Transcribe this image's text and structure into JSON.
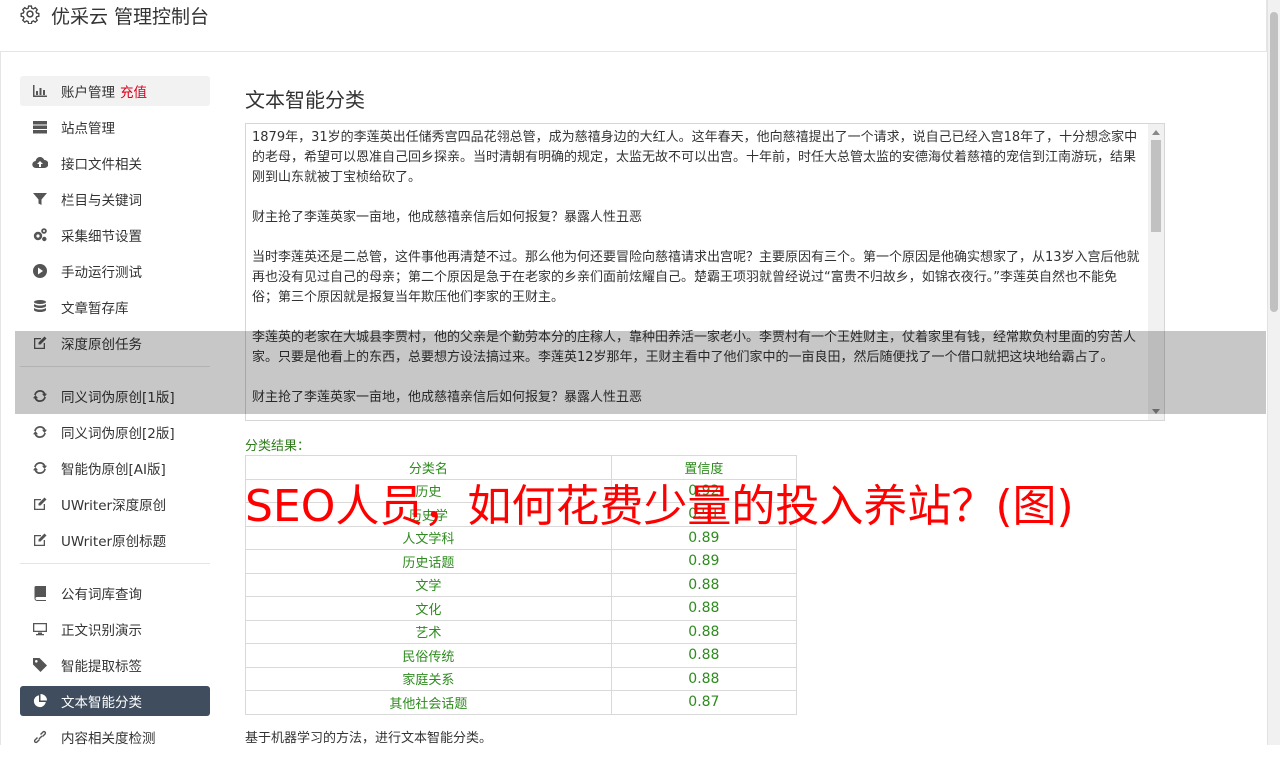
{
  "header": {
    "title": "优采云 管理控制台",
    "icon": "gear-icon"
  },
  "sidebar": {
    "group1": [
      {
        "label": "账户管理",
        "extra": "充值",
        "icon": "bar-chart-icon",
        "active": false
      },
      {
        "label": "站点管理",
        "icon": "server-icon"
      },
      {
        "label": "接口文件相关",
        "icon": "cloud-upload-icon"
      },
      {
        "label": "栏目与关键词",
        "icon": "filter-icon"
      },
      {
        "label": "采集细节设置",
        "icon": "cogs-icon"
      },
      {
        "label": "手动运行测试",
        "icon": "play-circle-icon"
      },
      {
        "label": "文章暂存库",
        "icon": "database-icon"
      },
      {
        "label": "深度原创任务",
        "icon": "edit-icon"
      }
    ],
    "group2": [
      {
        "label": "同义词伪原创[1版]",
        "icon": "refresh-icon"
      },
      {
        "label": "同义词伪原创[2版]",
        "icon": "refresh-icon"
      },
      {
        "label": "智能伪原创[AI版]",
        "icon": "refresh-icon"
      },
      {
        "label": "UWriter深度原创",
        "icon": "edit-icon"
      },
      {
        "label": "UWriter原创标题",
        "icon": "edit-icon"
      }
    ],
    "group3": [
      {
        "label": "公有词库查询",
        "icon": "book-icon"
      },
      {
        "label": "正文识别演示",
        "icon": "monitor-icon"
      },
      {
        "label": "智能提取标签",
        "icon": "tag-icon"
      },
      {
        "label": "文本智能分类",
        "icon": "pie-chart-icon",
        "active": true
      },
      {
        "label": "内容相关度检测",
        "icon": "link-icon"
      }
    ]
  },
  "main": {
    "title": "文本智能分类",
    "text_paragraphs": [
      "1879年，31岁的李莲英出任储秀宫四品花翎总管，成为慈禧身边的大红人。这年春天，他向慈禧提出了一个请求，说自己已经入宫18年了，十分想念家中的老母，希望可以恩准自己回乡探亲。当时清朝有明确的规定，太监无故不可以出宫。十年前，时任大总管太监的安德海仗着慈禧的宠信到江南游玩，结果刚到山东就被丁宝桢给砍了。",
      "财主抢了李莲英家一亩地，他成慈禧亲信后如何报复？暴露人性丑恶",
      "当时李莲英还是二总管，这件事他再清楚不过。那么他为何还要冒险向慈禧请求出宫呢？主要原因有三个。第一个原因是他确实想家了，从13岁入宫后他就再也没有见过自己的母亲；第二个原因是急于在老家的乡亲们面前炫耀自己。楚霸王项羽就曾经说过“富贵不归故乡，如锦衣夜行。”李莲英自然也不能免俗；第三个原因就是报复当年欺压他们李家的王财主。",
      "李莲英的老家在大城县李贾村，他的父亲是个勤劳本分的庄稼人，靠种田养活一家老小。李贾村有一个王姓财主，仗着家里有钱，经常欺负村里面的穷苦人家。只要是他看上的东西，总要想方设法搞过来。李莲英12岁那年，王财主看中了他们家中的一亩良田，然后随便找了一个借口就把这块地给霸占了。",
      "财主抢了李莲英家一亩地，他成慈禧亲信后如何报复？暴露人性丑恶"
    ],
    "result_label": "分类结果：",
    "table": {
      "headers": [
        "分类名",
        "置信度"
      ],
      "rows": [
        [
          "历史",
          "0.92"
        ],
        [
          "历史学",
          "0.91"
        ],
        [
          "人文学科",
          "0.89"
        ],
        [
          "历史话题",
          "0.89"
        ],
        [
          "文学",
          "0.88"
        ],
        [
          "文化",
          "0.88"
        ],
        [
          "艺术",
          "0.88"
        ],
        [
          "民俗传统",
          "0.88"
        ],
        [
          "家庭关系",
          "0.88"
        ],
        [
          "其他社会话题",
          "0.87"
        ]
      ]
    },
    "footnote": "基于机器学习的方法，进行文本智能分类。",
    "watermark": "SEO人员，如何花费少量的投入养站？(图)"
  },
  "colors": {
    "accent_active": "#3f4d5e",
    "result_green": "#2e8b1e",
    "watermark_red": "#ff0000",
    "recharge_red": "#d9001b"
  }
}
